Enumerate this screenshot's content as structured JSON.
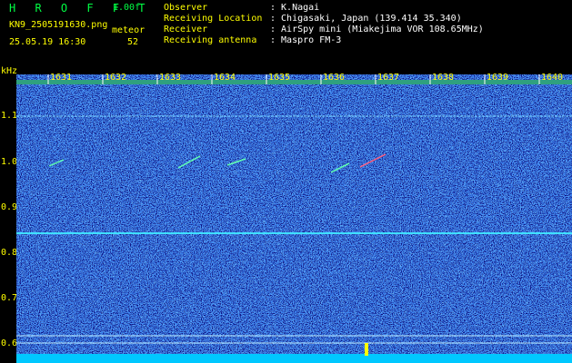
{
  "header": {
    "app_title": "H R O F F T",
    "version": "1.00f",
    "filename": "KN9_2505191630.png",
    "meteor_label": "meteor",
    "datetime": "25.05.19 16:30",
    "meteor_count": "52",
    "info": [
      {
        "label": "Observer",
        "value": ": K.Nagai"
      },
      {
        "label": "Receiving Location",
        "value": ": Chigasaki, Japan (139.414 35.340)"
      },
      {
        "label": "Receiver",
        "value": ": AirSpy mini (Miakejima VOR 108.65MHz)"
      },
      {
        "label": "Receiving antenna",
        "value": ": Maspro FM-3"
      }
    ]
  },
  "axis": {
    "unit": "kHz",
    "y_ticks": [
      "1.1",
      "1.0",
      "0.9",
      "0.8",
      "0.7",
      "0.6"
    ],
    "time_ticks": [
      "1631",
      "1632",
      "1633",
      "1634",
      "1635",
      "1636",
      "1637",
      "1638",
      "1639",
      "1640"
    ]
  },
  "colors": {
    "background_noise": "#1a2a9a",
    "grid_line": "#7fd7ff",
    "label": "#ffff00",
    "title": "#00ff44"
  }
}
